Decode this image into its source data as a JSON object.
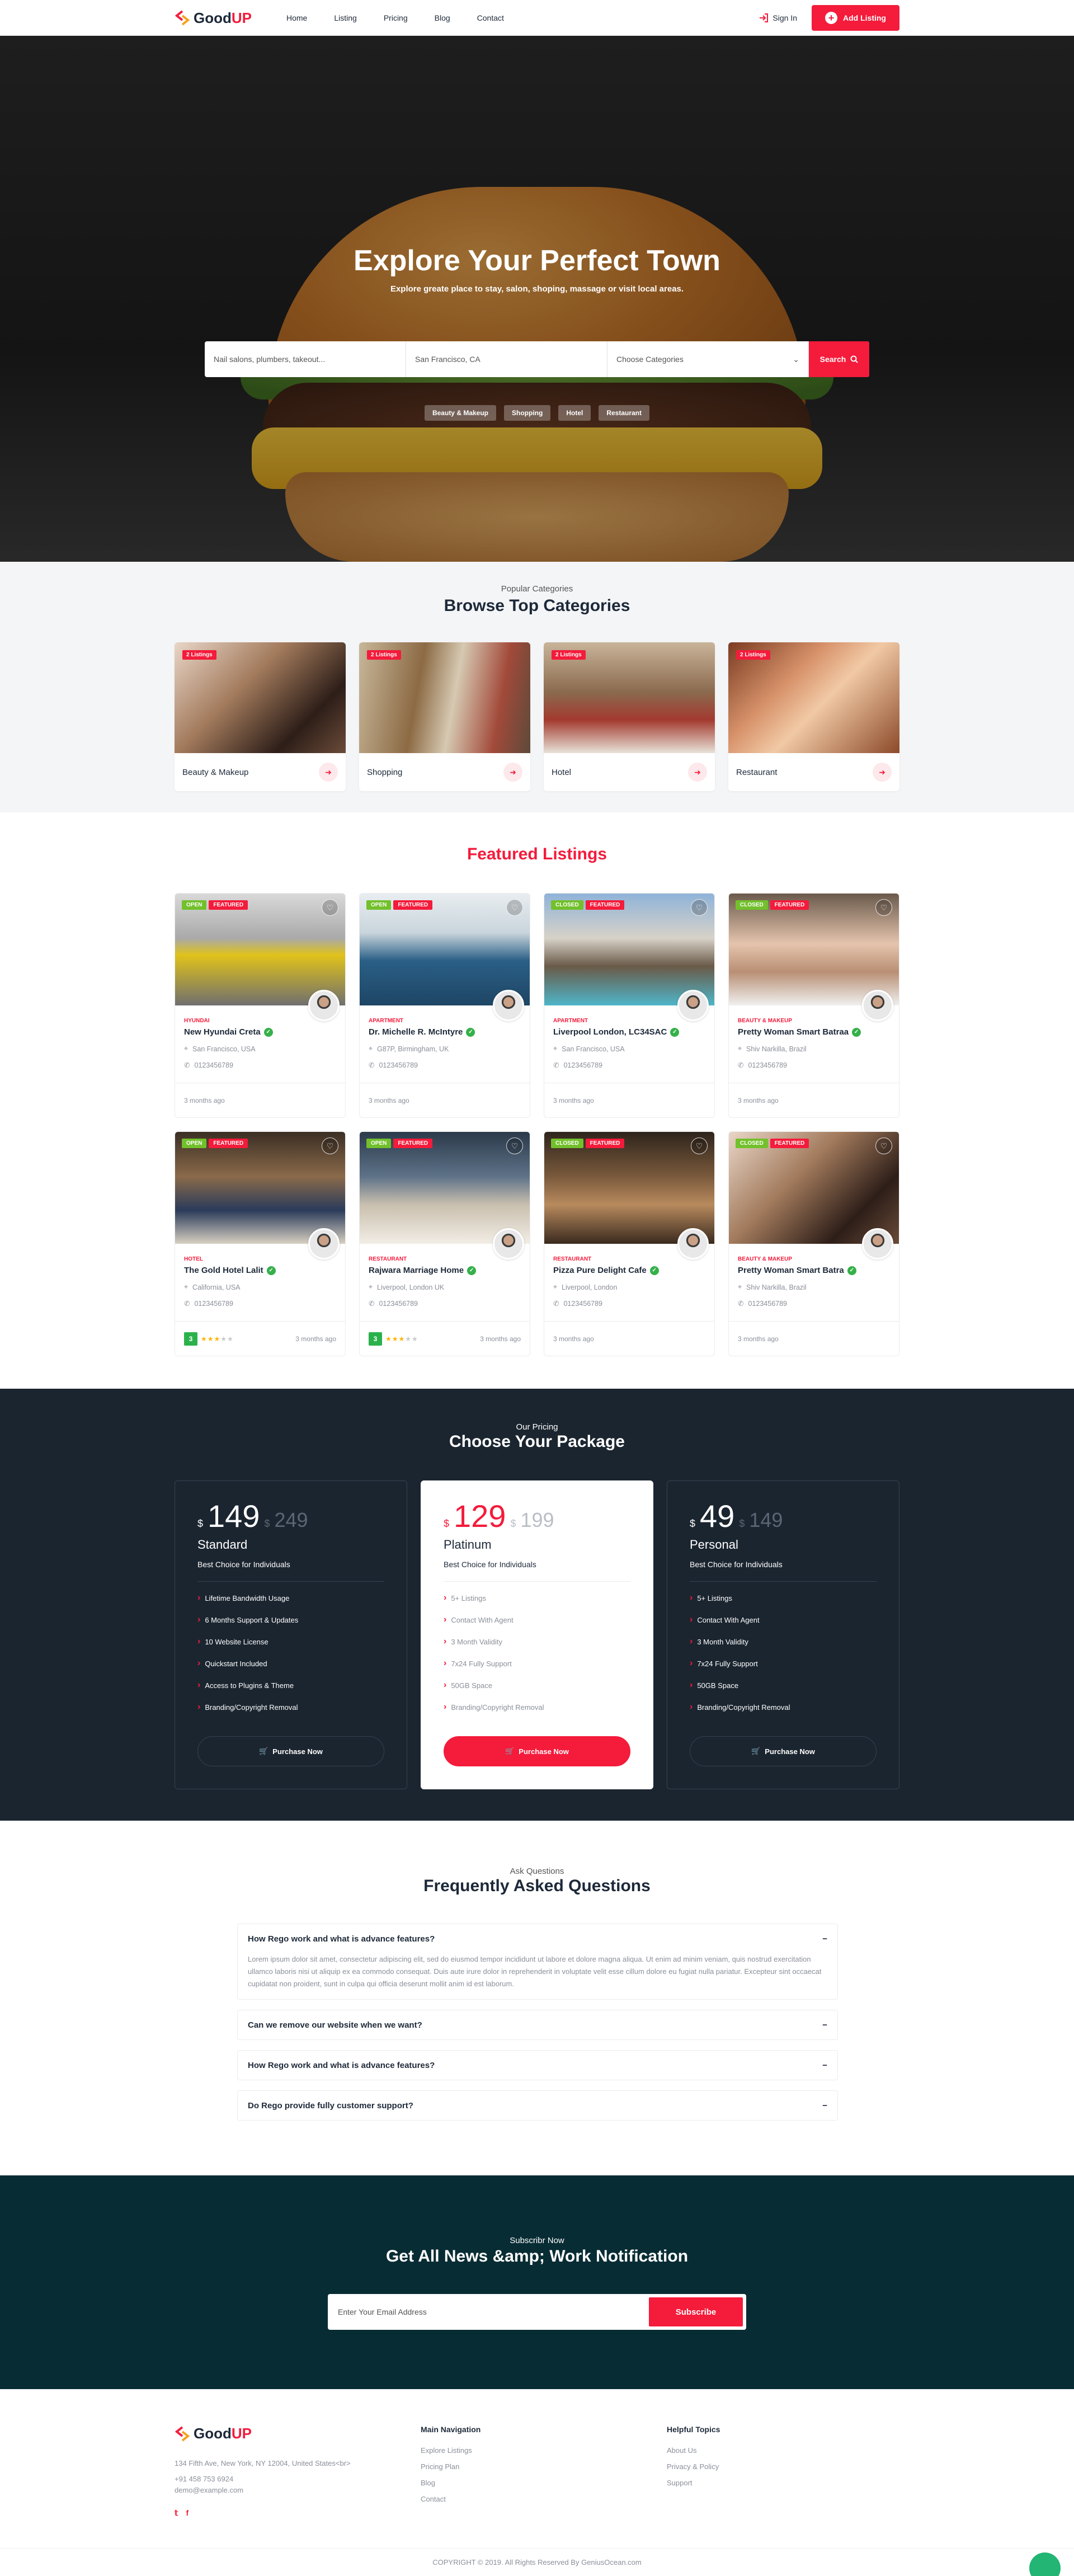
{
  "header": {
    "logo_good": "Good",
    "logo_up": "UP",
    "nav": [
      "Home",
      "Listing",
      "Pricing",
      "Blog",
      "Contact"
    ],
    "signin": "Sign In",
    "add_listing": "Add Listing"
  },
  "hero": {
    "title": "Explore Your Perfect Town",
    "subtitle": "Explore greate place to stay, salon, shoping, massage or visit local areas.",
    "keyword_placeholder": "Nail salons, plumbers, takeout...",
    "location_value": "San Francisco, CA",
    "category_value": "Choose Categories",
    "search_label": "Search",
    "tags": [
      "Beauty & Makeup",
      "Shopping",
      "Hotel",
      "Restaurant"
    ]
  },
  "categories": {
    "eyebrow": "Popular Categories",
    "title": "Browse Top Categories",
    "items": [
      {
        "badge": "2 Listings",
        "name": "Beauty & Makeup"
      },
      {
        "badge": "2 Listings",
        "name": "Shopping"
      },
      {
        "badge": "2 Listings",
        "name": "Hotel"
      },
      {
        "badge": "2 Listings",
        "name": "Restaurant"
      }
    ]
  },
  "featured": {
    "title": "Featured Listings",
    "items": [
      {
        "status": "OPEN",
        "feat": "FEATURED",
        "cat": "HYUNDAI",
        "title": "New Hyundai Creta",
        "loc": "San Francisco, USA",
        "phone": "0123456789",
        "time": "3 months ago"
      },
      {
        "status": "OPEN",
        "feat": "FEATURED",
        "cat": "APARTMENT",
        "title": "Dr. Michelle R. McIntyre",
        "loc": "G87P, Birmingham, UK",
        "phone": "0123456789",
        "time": "3 months ago"
      },
      {
        "status": "CLOSED",
        "feat": "FEATURED",
        "cat": "APARTMENT",
        "title": "Liverpool London, LC34SAC",
        "loc": "San Francisco, USA",
        "phone": "0123456789",
        "time": "3 months ago"
      },
      {
        "status": "CLOSED",
        "feat": "FEATURED",
        "cat": "BEAUTY & MAKEUP",
        "title": "Pretty Woman Smart Batraa",
        "loc": "Shiv Narkilla, Brazil",
        "phone": "0123456789",
        "time": "3 months ago"
      },
      {
        "status": "OPEN",
        "feat": "FEATURED",
        "cat": "HOTEL",
        "title": "The Gold Hotel Lalit",
        "loc": "California, USA",
        "phone": "0123456789",
        "time": "3 months ago",
        "rating": "3"
      },
      {
        "status": "OPEN",
        "feat": "FEATURED",
        "cat": "RESTAURANT",
        "title": "Rajwara Marriage Home",
        "loc": "Liverpool, London UK",
        "phone": "0123456789",
        "time": "3 months ago",
        "rating": "3"
      },
      {
        "status": "CLOSED",
        "feat": "FEATURED",
        "cat": "RESTAURANT",
        "title": "Pizza Pure Delight Cafe",
        "loc": "Liverpool, London",
        "phone": "0123456789",
        "time": "3 months ago"
      },
      {
        "status": "CLOSED",
        "feat": "FEATURED",
        "cat": "BEAUTY & MAKEUP",
        "title": "Pretty Woman Smart Batra",
        "loc": "Shiv Narkilla, Brazil",
        "phone": "0123456789",
        "time": "3 months ago"
      }
    ]
  },
  "pricing": {
    "eyebrow": "Our Pricing",
    "title": "Choose Your Package",
    "currency": "$",
    "plans": [
      {
        "price": "149",
        "old": "249",
        "name": "Standard",
        "sub": "Best Choice for Individuals",
        "features": [
          "Lifetime Bandwidth Usage",
          "6 Months Support & Updates",
          "10 Website License",
          "Quickstart Included",
          "Access to Plugins & Theme",
          "Branding/Copyright Removal"
        ],
        "cta": "Purchase Now"
      },
      {
        "price": "129",
        "old": "199",
        "name": "Platinum",
        "sub": "Best Choice for Individuals",
        "features": [
          "5+ Listings",
          "Contact With Agent",
          "3 Month Validity",
          "7x24 Fully Support",
          "50GB Space",
          "Branding/Copyright Removal"
        ],
        "cta": "Purchase Now"
      },
      {
        "price": "49",
        "old": "149",
        "name": "Personal",
        "sub": "Best Choice for Individuals",
        "features": [
          "5+ Listings",
          "Contact With Agent",
          "3 Month Validity",
          "7x24 Fully Support",
          "50GB Space",
          "Branding/Copyright Removal"
        ],
        "cta": "Purchase Now"
      }
    ]
  },
  "faq": {
    "eyebrow": "Ask Questions",
    "title": "Frequently Asked Questions",
    "items": [
      {
        "q": "How Rego work and what is advance features?",
        "a": "Lorem ipsum dolor sit amet, consectetur adipiscing elit, sed do eiusmod tempor incididunt ut labore et dolore magna aliqua. Ut enim ad minim veniam, quis nostrud exercitation ullamco laboris nisi ut aliquip ex ea commodo consequat. Duis aute irure dolor in reprehenderit in voluptate velit esse cillum dolore eu fugiat nulla pariatur. Excepteur sint occaecat cupidatat non proident, sunt in culpa qui officia deserunt mollit anim id est laborum."
      },
      {
        "q": "Can we remove our website when we want?"
      },
      {
        "q": "How Rego work and what is advance features?"
      },
      {
        "q": "Do Rego provide fully customer support?"
      }
    ]
  },
  "newsletter": {
    "eyebrow": "Subscribr Now",
    "title": "Get All News &amp; Work Notification",
    "placeholder": "Enter Your Email Address",
    "button": "Subscribe"
  },
  "footer": {
    "address": "134 Fifth Ave, New York, NY 12004, United States<br>",
    "phone": "+91 458 753 6924",
    "email": "demo@example.com",
    "nav_title": "Main Navigation",
    "nav": [
      "Explore Listings",
      "Pricing Plan",
      "Blog",
      "Contact"
    ],
    "help_title": "Helpful Topics",
    "help": [
      "About Us",
      "Privacy & Policy",
      "Support"
    ],
    "copyright": "COPYRIGHT © 2019. All Rights Reserved By GeniusOcean.com"
  },
  "colors": {
    "accent": "#f41b3b",
    "dark": "#1b2530",
    "teal": "#082c34",
    "green": "#72c02c"
  }
}
